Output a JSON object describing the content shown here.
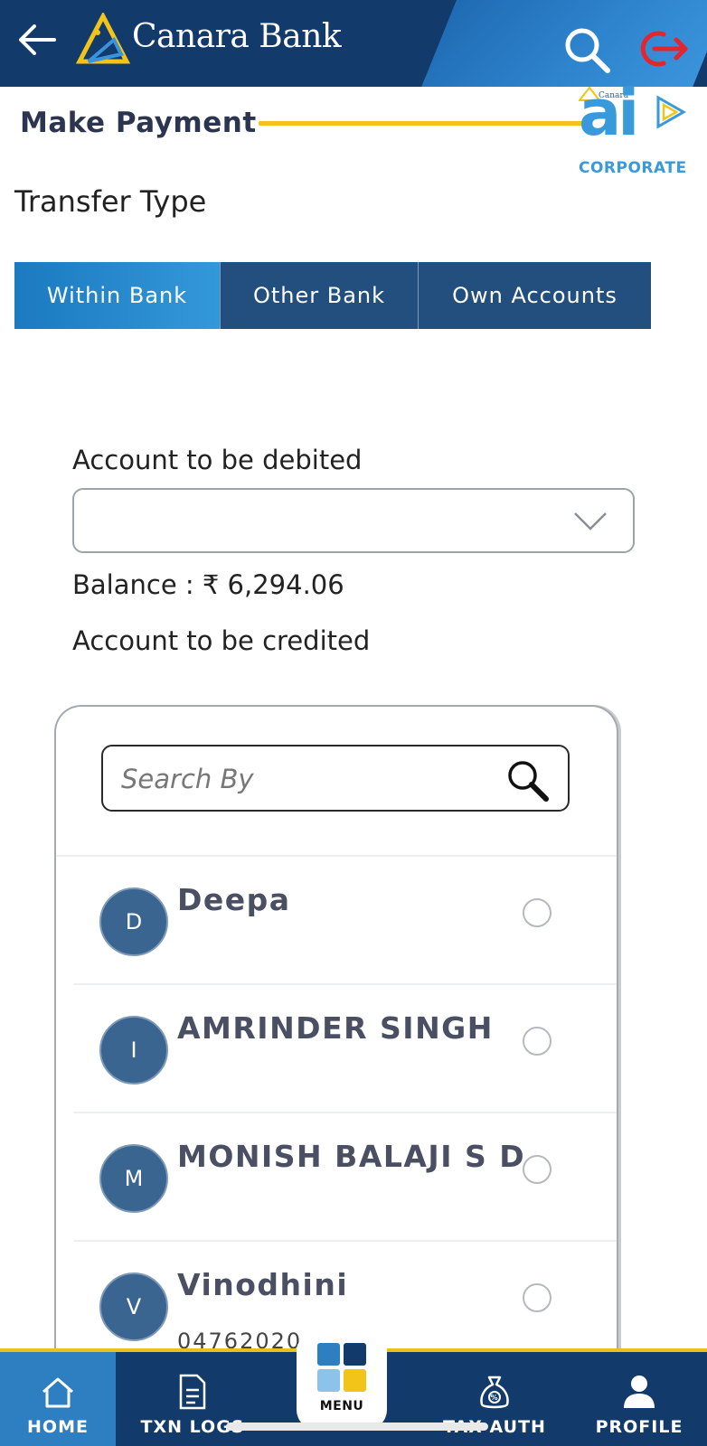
{
  "header": {
    "brand_name": "Canara Bank",
    "icons": {
      "back": "arrow-left-icon",
      "search": "search-icon",
      "logout": "logout-icon",
      "logo": "canara-bank-logo"
    },
    "colors": {
      "primary": "#123a6b",
      "accent": "#2f86cf",
      "logout": "#e3262e",
      "brand_yellow": "#f2c318"
    }
  },
  "page": {
    "title": "Make Payment",
    "corner_logo": {
      "brand": "Canara",
      "text": "ai",
      "tagline": "CORPORATE"
    }
  },
  "transfer": {
    "label": "Transfer Type",
    "tabs": [
      {
        "label": "Within Bank",
        "active": true
      },
      {
        "label": "Other Bank",
        "active": false
      },
      {
        "label": "Own Accounts",
        "active": false
      }
    ]
  },
  "debit": {
    "label": "Account to be debited",
    "selected_value": "",
    "balance_label": "Balance :",
    "balance_value": "₹ 6,294.06"
  },
  "credit": {
    "label": "Account to be credited",
    "search_placeholder": "Search By",
    "beneficiaries": [
      {
        "initial": "D",
        "name": "Deepa",
        "selected": false
      },
      {
        "initial": "I",
        "name": "AMRINDER SINGH",
        "selected": false
      },
      {
        "initial": "M",
        "name": "MONISH BALAJI S D",
        "selected": false
      },
      {
        "initial": "V",
        "name": "Vinodhini",
        "sub": "04762020",
        "selected": false
      }
    ]
  },
  "bottom_nav": {
    "items": [
      {
        "label": "HOME",
        "icon": "home-icon",
        "active": true
      },
      {
        "label": "TXN LOGS",
        "icon": "document-icon",
        "active": false
      },
      {
        "label": "MENU",
        "icon": "grid-icon",
        "active": false
      },
      {
        "label": "TAX AUTH",
        "icon": "tax-bag-icon",
        "active": false
      },
      {
        "label": "PROFILE",
        "icon": "user-icon",
        "active": false
      }
    ]
  }
}
